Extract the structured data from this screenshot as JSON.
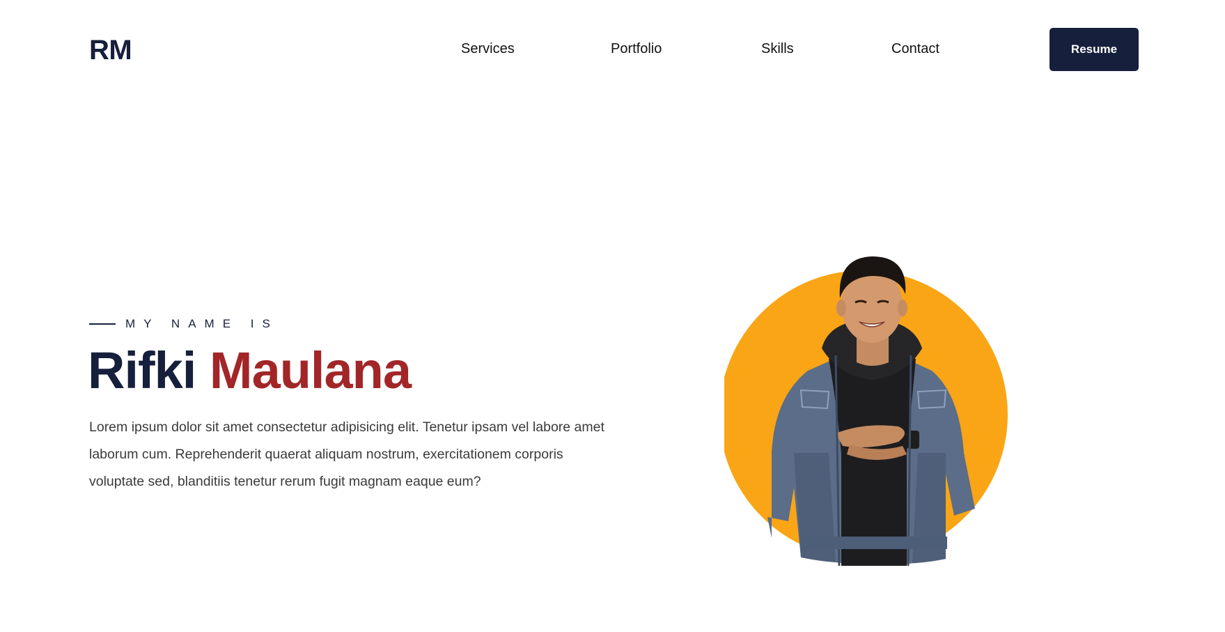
{
  "header": {
    "logo": "RM",
    "nav": [
      {
        "label": "Services"
      },
      {
        "label": "Portfolio"
      },
      {
        "label": "Skills"
      },
      {
        "label": "Contact"
      }
    ],
    "resume_label": "Resume"
  },
  "hero": {
    "intro": "MY NAME IS",
    "first_name": "Rifki",
    "last_name": "Maulana",
    "bio": "Lorem ipsum dolor sit amet consectetur adipisicing elit. Tenetur ipsam vel labore amet laborum cum. Reprehenderit quaerat aliquam nostrum, exercitationem corporis voluptate sed, blanditiis tenetur rerum fugit magnam eaque eum?"
  },
  "colors": {
    "primary": "#161f3b",
    "accent": "#a22628",
    "circle": "#faa515"
  }
}
